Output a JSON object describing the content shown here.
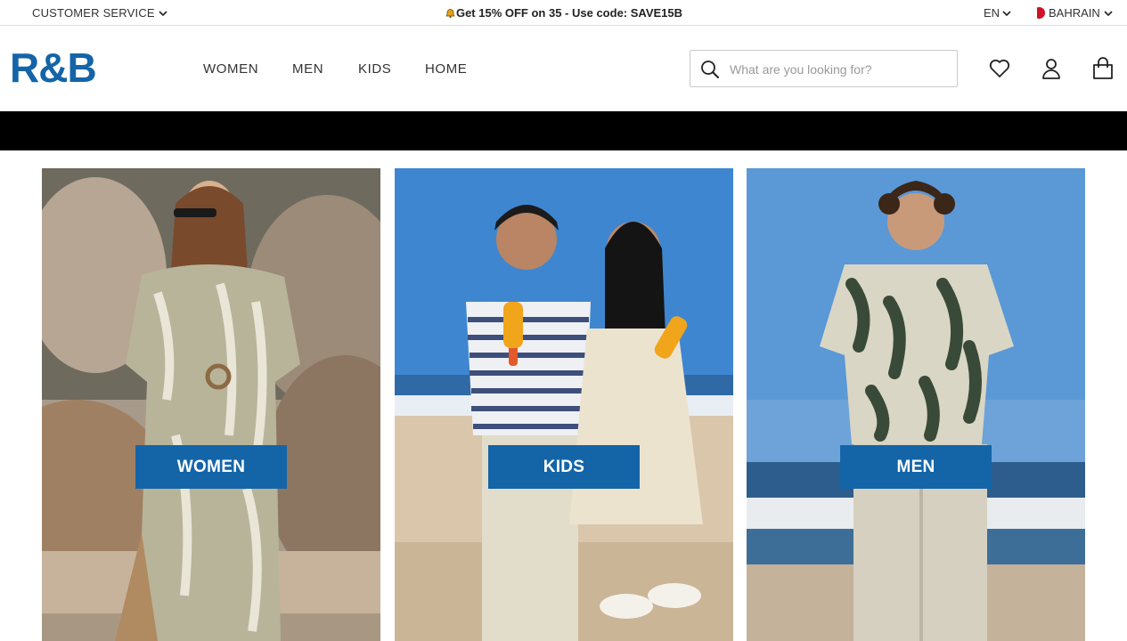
{
  "topbar": {
    "customer_service": "CUSTOMER SERVICE",
    "promo_icon": "bell-icon",
    "promo": "Get 15% OFF on 35 - Use code: SAVE15B",
    "language": "EN",
    "country": "BAHRAIN"
  },
  "header": {
    "logo": "R&B",
    "nav": [
      "WOMEN",
      "MEN",
      "KIDS",
      "HOME"
    ],
    "search_placeholder": "What are you looking for?",
    "search_value": "",
    "icons": [
      "search-icon",
      "heart-icon",
      "user-icon",
      "bag-icon"
    ]
  },
  "tiles": [
    {
      "label": "WOMEN",
      "image": "woman-beach-dress"
    },
    {
      "label": "KIDS",
      "image": "kids-beach-icecream"
    },
    {
      "label": "MEN",
      "image": "man-beach-shirt"
    }
  ],
  "colors": {
    "brand": "#1465a8",
    "banner": "#000000",
    "text": "#333333"
  }
}
